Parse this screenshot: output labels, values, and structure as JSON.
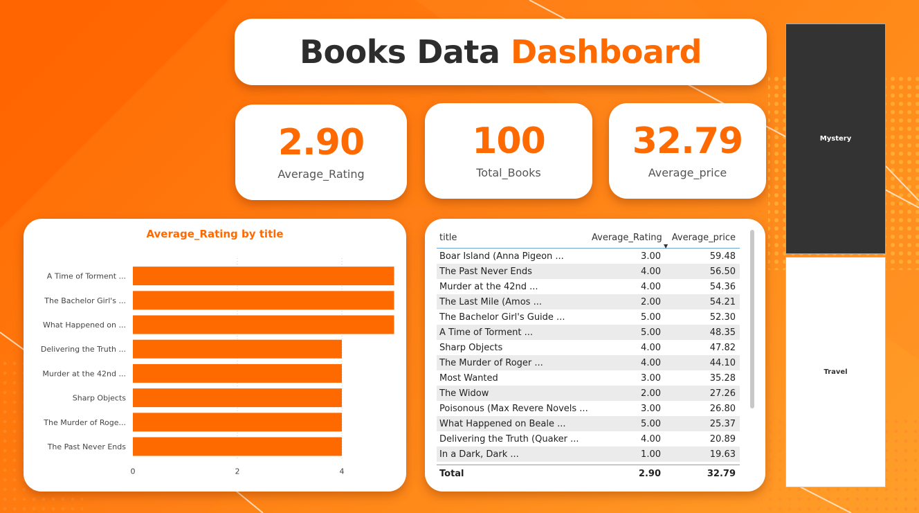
{
  "header": {
    "title_part1": "Books Data",
    "title_part2": "Dashboard"
  },
  "kpis": [
    {
      "value": "2.90",
      "label": "Average_Rating"
    },
    {
      "value": "100",
      "label": "Total_Books"
    },
    {
      "value": "32.79",
      "label": "Average_price"
    }
  ],
  "chart_data": {
    "type": "bar",
    "orientation": "horizontal",
    "title": "Average_Rating by title",
    "categories": [
      "A Time of Torment ...",
      "The Bachelor Girl's ...",
      "What Happened on ...",
      "Delivering the Truth ...",
      "Murder at the 42nd ...",
      "Sharp Objects",
      "The Murder of Roge...",
      "The Past Never Ends"
    ],
    "values": [
      5,
      5,
      5,
      4,
      4,
      4,
      4,
      4
    ],
    "x_ticks": [
      "0",
      "2",
      "4"
    ],
    "xlim": [
      0,
      5
    ],
    "grid": true,
    "bar_color": "#ff6a00"
  },
  "table": {
    "headers": [
      "title",
      "Average_Rating",
      "Average_price"
    ],
    "rows": [
      [
        "Boar Island (Anna Pigeon ...",
        "3.00",
        "59.48"
      ],
      [
        "The Past Never Ends",
        "4.00",
        "56.50"
      ],
      [
        "Murder at the 42nd ...",
        "4.00",
        "54.36"
      ],
      [
        "The Last Mile (Amos ...",
        "2.00",
        "54.21"
      ],
      [
        "The Bachelor Girl's Guide ...",
        "5.00",
        "52.30"
      ],
      [
        "A Time of Torment ...",
        "5.00",
        "48.35"
      ],
      [
        "Sharp Objects",
        "4.00",
        "47.82"
      ],
      [
        "The Murder of Roger ...",
        "4.00",
        "44.10"
      ],
      [
        "Most Wanted",
        "3.00",
        "35.28"
      ],
      [
        "The Widow",
        "2.00",
        "27.26"
      ],
      [
        "Poisonous (Max Revere Novels ...",
        "3.00",
        "26.80"
      ],
      [
        "What Happened on Beale ...",
        "5.00",
        "25.37"
      ],
      [
        "Delivering the Truth (Quaker ...",
        "4.00",
        "20.89"
      ],
      [
        "In a Dark, Dark ...",
        "1.00",
        "19.63"
      ]
    ],
    "total": [
      "Total",
      "2.90",
      "32.79"
    ]
  },
  "slicers": {
    "mystery": "Mystery",
    "travel": "Travel"
  },
  "colors": {
    "accent": "#ff6a00",
    "dark": "#2d2d2d",
    "slicer_selected": "#333333"
  }
}
